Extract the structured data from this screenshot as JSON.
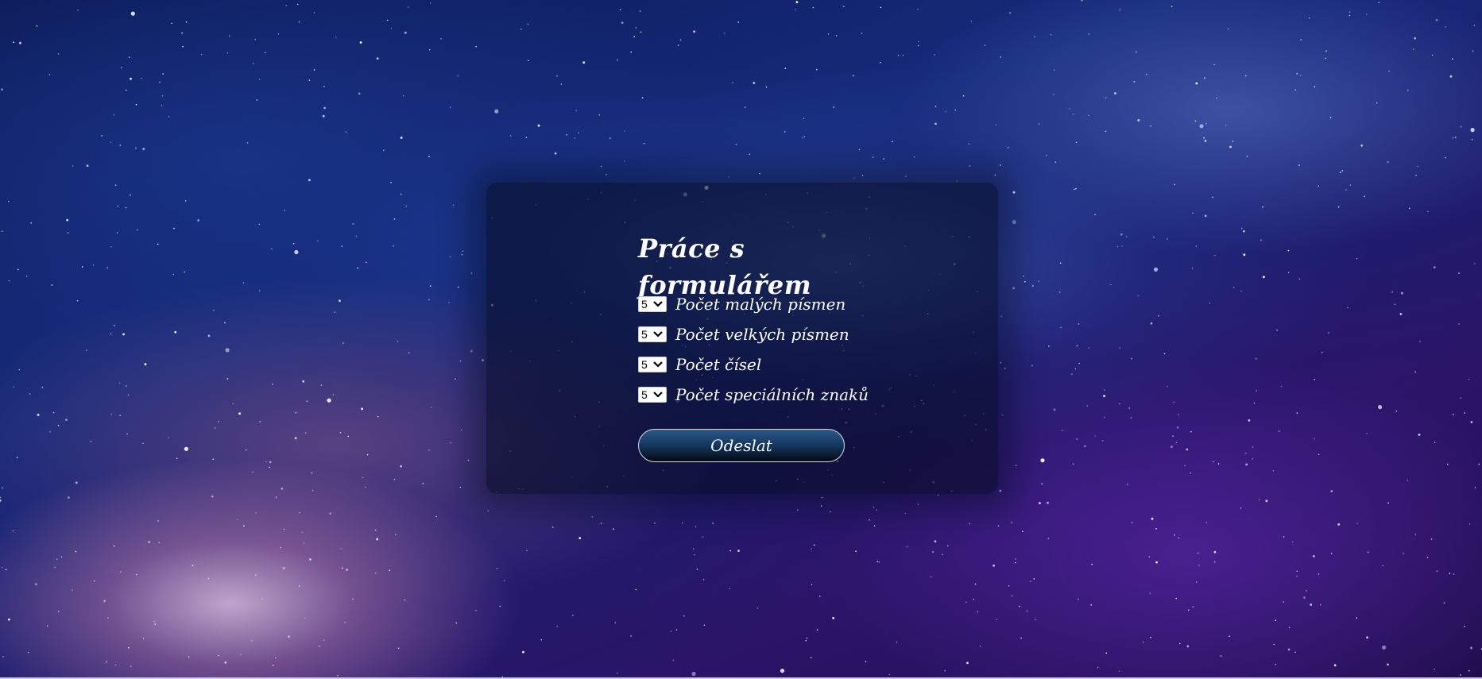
{
  "form": {
    "title": "Práce s formulářem",
    "fields": [
      {
        "value": "5",
        "label": "Počet malých písmen"
      },
      {
        "value": "5",
        "label": "Počet velkých písmen"
      },
      {
        "value": "5",
        "label": "Počet čísel"
      },
      {
        "value": "5",
        "label": "Počet speciálních znaků"
      }
    ],
    "submit_label": "Odeslat"
  },
  "colors": {
    "panel": "#050c23",
    "button_top": "#2b5a88",
    "button_bottom": "#04080f",
    "text": "#ffffff"
  },
  "icons": {
    "select_indicator": "chevron-down-icon"
  }
}
